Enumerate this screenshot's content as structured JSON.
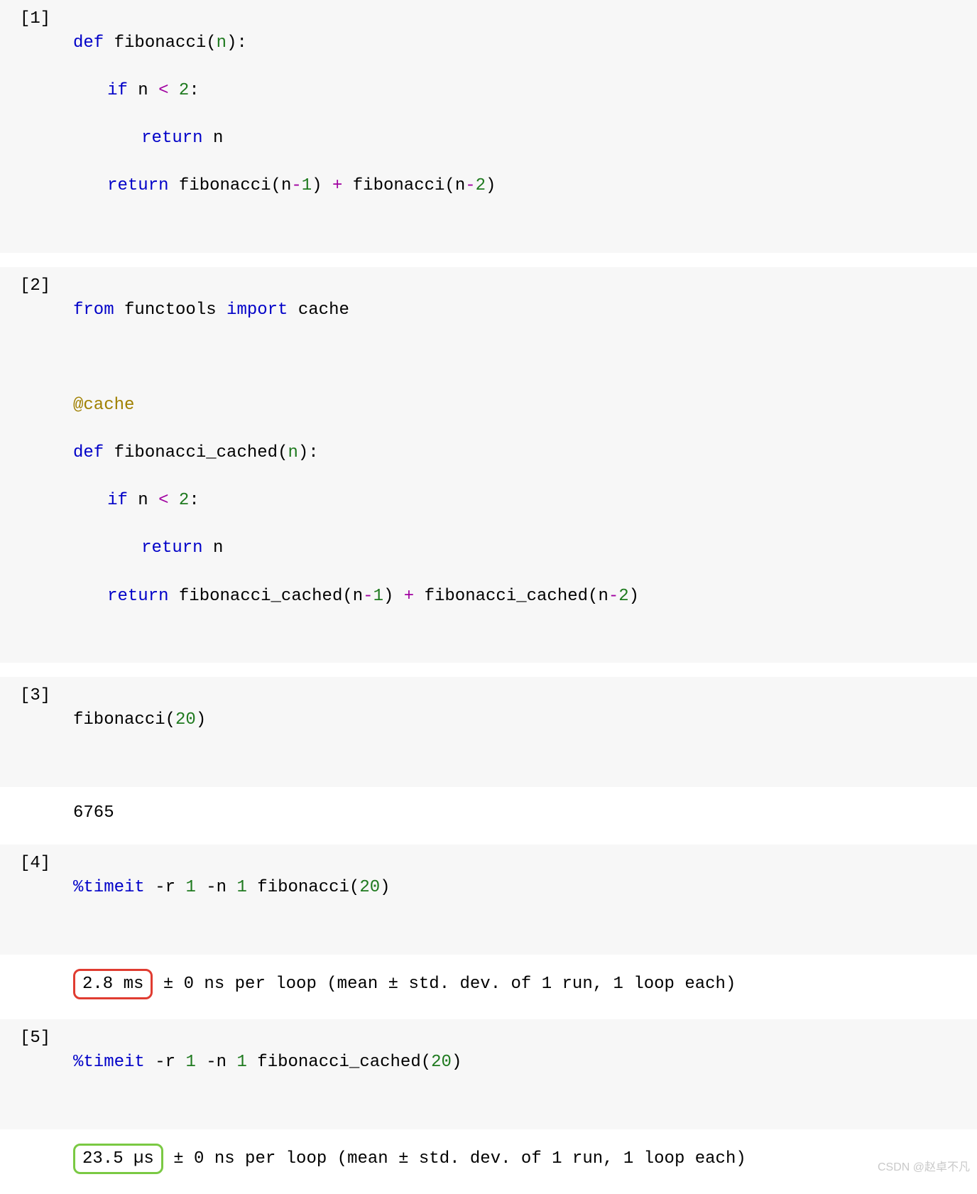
{
  "cells": [
    {
      "prompt": "[1]",
      "type": "code"
    },
    {
      "prompt": "[2]",
      "type": "code"
    },
    {
      "prompt": "[3]",
      "type": "code"
    },
    {
      "prompt": "",
      "type": "output"
    },
    {
      "prompt": "[4]",
      "type": "code"
    },
    {
      "prompt": "",
      "type": "output"
    },
    {
      "prompt": "[5]",
      "type": "code"
    },
    {
      "prompt": "",
      "type": "output"
    }
  ],
  "c1": {
    "l1": {
      "def": "def",
      "sp1": " ",
      "fn": "fibonacci",
      "lp": "(",
      "p": "n",
      "rp": ")",
      "colon": ":"
    },
    "l2": {
      "if": "if",
      "sp": " ",
      "v": "n ",
      "lt": "<",
      "sp2": " ",
      "n": "2",
      "colon": ":"
    },
    "l3": {
      "ret": "return",
      "sp": " ",
      "v": "n"
    },
    "l4": {
      "ret": "return",
      "sp": " ",
      "fn1": "fibonacci",
      "lp1": "(",
      "v1": "n",
      "op1": "-",
      "n1": "1",
      "rp1": ")",
      "sp2": " ",
      "plus": "+",
      "sp3": " ",
      "fn2": "fibonacci",
      "lp2": "(",
      "v2": "n",
      "op2": "-",
      "n2": "2",
      "rp2": ")"
    }
  },
  "c2": {
    "l1": {
      "from": "from",
      "sp1": " ",
      "mod": "functools",
      "sp2": " ",
      "imp": "import",
      "sp3": " ",
      "name": "cache"
    },
    "l2": {
      "deco": "@cache"
    },
    "l3": {
      "def": "def",
      "sp": " ",
      "fn": "fibonacci_cached",
      "lp": "(",
      "p": "n",
      "rp": ")",
      "colon": ":"
    },
    "l4": {
      "if": "if",
      "sp": " ",
      "v": "n ",
      "lt": "<",
      "sp2": " ",
      "n": "2",
      "colon": ":"
    },
    "l5": {
      "ret": "return",
      "sp": " ",
      "v": "n"
    },
    "l6": {
      "ret": "return",
      "sp": " ",
      "fn1": "fibonacci_cached",
      "lp1": "(",
      "v1": "n",
      "op1": "-",
      "n1": "1",
      "rp1": ")",
      "sp2": " ",
      "plus": "+",
      "sp3": " ",
      "fn2": "fibonacci_cached",
      "lp2": "(",
      "v2": "n",
      "op2": "-",
      "n2": "2",
      "rp2": ")"
    }
  },
  "c3": {
    "fn": "fibonacci",
    "lp": "(",
    "n": "20",
    "rp": ")"
  },
  "o3": {
    "val": "6765"
  },
  "c4": {
    "magic": "%timeit",
    "sp1": " ",
    "opt1": "-r",
    "sp2": " ",
    "v1": "1",
    "sp3": " ",
    "opt2": "-n",
    "sp4": " ",
    "v2": "1",
    "sp5": " ",
    "fn": "fibonacci",
    "lp": "(",
    "n": "20",
    "rp": ")"
  },
  "o4": {
    "boxed": "2.8 ms",
    "rest": " ± 0 ns per loop (mean ± std. dev. of 1 run, 1 loop each)"
  },
  "c5": {
    "magic": "%timeit",
    "sp1": " ",
    "opt1": "-r",
    "sp2": " ",
    "v1": "1",
    "sp3": " ",
    "opt2": "-n",
    "sp4": " ",
    "v2": "1",
    "sp5": " ",
    "fn": "fibonacci_cached",
    "lp": "(",
    "n": "20",
    "rp": ")"
  },
  "o5": {
    "boxed": "23.5 µs",
    "rest": " ± 0 ns per loop (mean ± std. dev. of 1 run, 1 loop each)"
  },
  "watermark": "CSDN @赵卓不凡"
}
